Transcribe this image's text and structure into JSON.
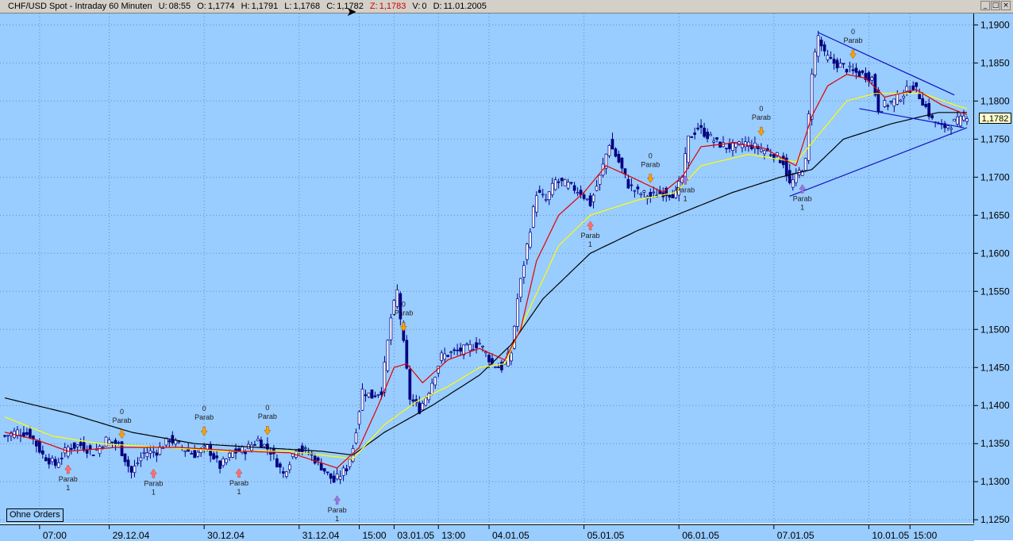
{
  "window": {
    "title": "CHF/USD Spot - Intraday 60 Minuten",
    "stats": [
      {
        "key": "U:",
        "value": "08:55"
      },
      {
        "key": "O:",
        "value": "1,1774"
      },
      {
        "key": "H:",
        "value": "1,1791"
      },
      {
        "key": "L:",
        "value": "1,1768"
      },
      {
        "key": "C:",
        "value": "1,1782"
      }
    ],
    "z_key": "Z:",
    "z_value": "1,1783",
    "v_key": "V:",
    "v_value": "0",
    "d_key": "D:",
    "d_value": "11.01.2005",
    "btn_min": "_",
    "btn_max": "□",
    "btn_close": "×"
  },
  "ohne_orders": "Ohne Orders",
  "last_price": "1,1782",
  "colors": {
    "background": "#99ccff",
    "candles": "#000080",
    "ma_fast": "#e00000",
    "ma_mid": "#ffff00",
    "ma_slow": "#000000",
    "trendline": "#1010c0",
    "signal_up": "#ff7070",
    "signal_up_alt": "#8080ff",
    "signal_down": "#ffa000"
  },
  "chart_data": {
    "type": "candlestick",
    "ylim": [
      1.1245,
      1.1915
    ],
    "y_ticks": [
      "1,1900",
      "1,1850",
      "1,1800",
      "1,1750",
      "1,1700",
      "1,1650",
      "1,1600",
      "1,1550",
      "1,1500",
      "1,1450",
      "1,1400",
      "1,1350",
      "1,1300",
      "1,1250"
    ],
    "y_values": [
      1.19,
      1.185,
      1.18,
      1.175,
      1.17,
      1.165,
      1.16,
      1.155,
      1.15,
      1.145,
      1.14,
      1.135,
      1.13,
      1.125
    ],
    "x_labels": [
      {
        "label": "07:00",
        "bar": 11
      },
      {
        "label": "29.12.04",
        "bar": 33
      },
      {
        "label": "30.12.04",
        "bar": 63
      },
      {
        "label": "31.12.04",
        "bar": 93
      },
      {
        "label": "15:00",
        "bar": 112
      },
      {
        "label": "03.01.05",
        "bar": 123
      },
      {
        "label": "13:00",
        "bar": 137
      },
      {
        "label": "04.01.05",
        "bar": 153
      },
      {
        "label": "05.01.05",
        "bar": 183
      },
      {
        "label": "06.01.05",
        "bar": 213
      },
      {
        "label": "07.01.05",
        "bar": 243
      },
      {
        "label": "10.01.05",
        "bar": 273
      },
      {
        "label": "15:00",
        "bar": 286
      }
    ],
    "bars": 305,
    "close_anchors": [
      [
        0,
        1.136
      ],
      [
        4,
        1.1366
      ],
      [
        8,
        1.1362
      ],
      [
        12,
        1.1335
      ],
      [
        16,
        1.1322
      ],
      [
        20,
        1.1345
      ],
      [
        24,
        1.1348
      ],
      [
        28,
        1.1338
      ],
      [
        32,
        1.1355
      ],
      [
        36,
        1.1348
      ],
      [
        40,
        1.1312
      ],
      [
        44,
        1.1338
      ],
      [
        48,
        1.134
      ],
      [
        52,
        1.1356
      ],
      [
        56,
        1.1345
      ],
      [
        60,
        1.1336
      ],
      [
        64,
        1.1345
      ],
      [
        68,
        1.132
      ],
      [
        72,
        1.1338
      ],
      [
        76,
        1.1342
      ],
      [
        80,
        1.1355
      ],
      [
        84,
        1.134
      ],
      [
        88,
        1.131
      ],
      [
        92,
        1.1345
      ],
      [
        96,
        1.1338
      ],
      [
        100,
        1.132
      ],
      [
        104,
        1.13
      ],
      [
        108,
        1.1318
      ],
      [
        110,
        1.1345
      ],
      [
        113,
        1.142
      ],
      [
        116,
        1.1412
      ],
      [
        119,
        1.142
      ],
      [
        122,
        1.1515
      ],
      [
        124,
        1.155
      ],
      [
        126,
        1.148
      ],
      [
        128,
        1.141
      ],
      [
        131,
        1.1395
      ],
      [
        134,
        1.142
      ],
      [
        138,
        1.1465
      ],
      [
        142,
        1.147
      ],
      [
        146,
        1.1475
      ],
      [
        150,
        1.1482
      ],
      [
        154,
        1.1455
      ],
      [
        157,
        1.145
      ],
      [
        160,
        1.147
      ],
      [
        162,
        1.154
      ],
      [
        165,
        1.161
      ],
      [
        168,
        1.168
      ],
      [
        171,
        1.167
      ],
      [
        174,
        1.1695
      ],
      [
        178,
        1.169
      ],
      [
        182,
        1.168
      ],
      [
        185,
        1.1665
      ],
      [
        188,
        1.17
      ],
      [
        191,
        1.1745
      ],
      [
        194,
        1.172
      ],
      [
        197,
        1.169
      ],
      [
        200,
        1.168
      ],
      [
        204,
        1.1675
      ],
      [
        208,
        1.168
      ],
      [
        212,
        1.1678
      ],
      [
        214,
        1.17
      ],
      [
        216,
        1.175
      ],
      [
        219,
        1.1765
      ],
      [
        222,
        1.1755
      ],
      [
        225,
        1.1745
      ],
      [
        228,
        1.174
      ],
      [
        231,
        1.174
      ],
      [
        234,
        1.1745
      ],
      [
        237,
        1.174
      ],
      [
        240,
        1.1735
      ],
      [
        243,
        1.173
      ],
      [
        246,
        1.172
      ],
      [
        248,
        1.169
      ],
      [
        250,
        1.17
      ],
      [
        253,
        1.172
      ],
      [
        255,
        1.184
      ],
      [
        257,
        1.1885
      ],
      [
        259,
        1.186
      ],
      [
        262,
        1.185
      ],
      [
        265,
        1.1845
      ],
      [
        268,
        1.1838
      ],
      [
        271,
        1.1835
      ],
      [
        274,
        1.183
      ],
      [
        276,
        1.179
      ],
      [
        278,
        1.1795
      ],
      [
        281,
        1.18
      ],
      [
        284,
        1.181
      ],
      [
        287,
        1.182
      ],
      [
        290,
        1.18
      ],
      [
        293,
        1.1775
      ],
      [
        296,
        1.1765
      ],
      [
        299,
        1.177
      ],
      [
        302,
        1.1775
      ],
      [
        304,
        1.1782
      ]
    ],
    "ma_slow_anchors": [
      [
        0,
        1.141
      ],
      [
        20,
        1.139
      ],
      [
        40,
        1.1365
      ],
      [
        60,
        1.135
      ],
      [
        80,
        1.1345
      ],
      [
        100,
        1.134
      ],
      [
        110,
        1.1335
      ],
      [
        120,
        1.1365
      ],
      [
        135,
        1.14
      ],
      [
        150,
        1.144
      ],
      [
        160,
        1.148
      ],
      [
        170,
        1.154
      ],
      [
        185,
        1.16
      ],
      [
        200,
        1.163
      ],
      [
        215,
        1.1655
      ],
      [
        230,
        1.168
      ],
      [
        245,
        1.17
      ],
      [
        255,
        1.171
      ],
      [
        265,
        1.175
      ],
      [
        280,
        1.177
      ],
      [
        295,
        1.1785
      ],
      [
        304,
        1.1785
      ]
    ],
    "ma_mid_anchors": [
      [
        0,
        1.1385
      ],
      [
        15,
        1.136
      ],
      [
        30,
        1.135
      ],
      [
        50,
        1.1345
      ],
      [
        70,
        1.134
      ],
      [
        90,
        1.134
      ],
      [
        110,
        1.133
      ],
      [
        120,
        1.1375
      ],
      [
        130,
        1.1405
      ],
      [
        140,
        1.1425
      ],
      [
        150,
        1.145
      ],
      [
        158,
        1.1455
      ],
      [
        165,
        1.152
      ],
      [
        175,
        1.161
      ],
      [
        185,
        1.165
      ],
      [
        200,
        1.167
      ],
      [
        212,
        1.168
      ],
      [
        220,
        1.1715
      ],
      [
        235,
        1.173
      ],
      [
        250,
        1.172
      ],
      [
        258,
        1.176
      ],
      [
        266,
        1.18
      ],
      [
        275,
        1.181
      ],
      [
        290,
        1.181
      ],
      [
        300,
        1.1795
      ],
      [
        304,
        1.179
      ]
    ],
    "ma_fast_anchors": [
      [
        0,
        1.1365
      ],
      [
        10,
        1.1355
      ],
      [
        20,
        1.134
      ],
      [
        35,
        1.1345
      ],
      [
        55,
        1.1345
      ],
      [
        75,
        1.134
      ],
      [
        90,
        1.1338
      ],
      [
        105,
        1.1318
      ],
      [
        112,
        1.1345
      ],
      [
        118,
        1.14
      ],
      [
        123,
        1.145
      ],
      [
        127,
        1.1455
      ],
      [
        132,
        1.143
      ],
      [
        140,
        1.146
      ],
      [
        150,
        1.1475
      ],
      [
        158,
        1.146
      ],
      [
        163,
        1.15
      ],
      [
        168,
        1.159
      ],
      [
        175,
        1.165
      ],
      [
        183,
        1.168
      ],
      [
        190,
        1.1715
      ],
      [
        198,
        1.17
      ],
      [
        208,
        1.168
      ],
      [
        214,
        1.17
      ],
      [
        220,
        1.174
      ],
      [
        230,
        1.1745
      ],
      [
        240,
        1.1738
      ],
      [
        250,
        1.1715
      ],
      [
        255,
        1.178
      ],
      [
        260,
        1.182
      ],
      [
        266,
        1.1835
      ],
      [
        272,
        1.183
      ],
      [
        278,
        1.1805
      ],
      [
        288,
        1.1815
      ],
      [
        296,
        1.1795
      ],
      [
        304,
        1.1782
      ]
    ],
    "trendlines": [
      [
        [
          257,
          1.189
        ],
        [
          300,
          1.1808
        ]
      ],
      [
        [
          270,
          1.179
        ],
        [
          303,
          1.1765
        ]
      ],
      [
        [
          248,
          1.1675
        ],
        [
          304,
          1.1765
        ]
      ]
    ],
    "signals": [
      {
        "bar": 20,
        "dir": "up",
        "color": "#ff7070",
        "label": "Parab",
        "sub": "1"
      },
      {
        "bar": 37,
        "dir": "down",
        "color": "#ffa000",
        "label": "Parab",
        "top": "0"
      },
      {
        "bar": 47,
        "dir": "up",
        "color": "#ff7070",
        "label": "Parab",
        "sub": "1"
      },
      {
        "bar": 63,
        "dir": "down",
        "color": "#ffa000",
        "label": "Parab",
        "top": "0"
      },
      {
        "bar": 74,
        "dir": "up",
        "color": "#ff7070",
        "label": "Parab",
        "sub": "1"
      },
      {
        "bar": 83,
        "dir": "down",
        "color": "#ffa000",
        "label": "Parab",
        "top": "0"
      },
      {
        "bar": 105,
        "dir": "up",
        "color": "#8080ff",
        "label": "Parab",
        "sub": "1"
      },
      {
        "bar": 126,
        "dir": "down",
        "color": "#ffa000",
        "label": "Parab",
        "top": "0"
      },
      {
        "bar": 185,
        "dir": "up",
        "color": "#ff7070",
        "label": "Parab",
        "sub": "1"
      },
      {
        "bar": 204,
        "dir": "down",
        "color": "#ffa000",
        "label": "Parab",
        "top": "0"
      },
      {
        "bar": 215,
        "dir": "up",
        "color": "#8080ff",
        "label": "Parab",
        "sub": "1"
      },
      {
        "bar": 239,
        "dir": "down",
        "color": "#ffa000",
        "label": "Parab",
        "top": "0"
      },
      {
        "bar": 252,
        "dir": "up",
        "color": "#8080ff",
        "label": "Parab",
        "sub": "1"
      },
      {
        "bar": 268,
        "dir": "down",
        "color": "#ffa000",
        "label": "Parab",
        "top": "0"
      }
    ]
  }
}
